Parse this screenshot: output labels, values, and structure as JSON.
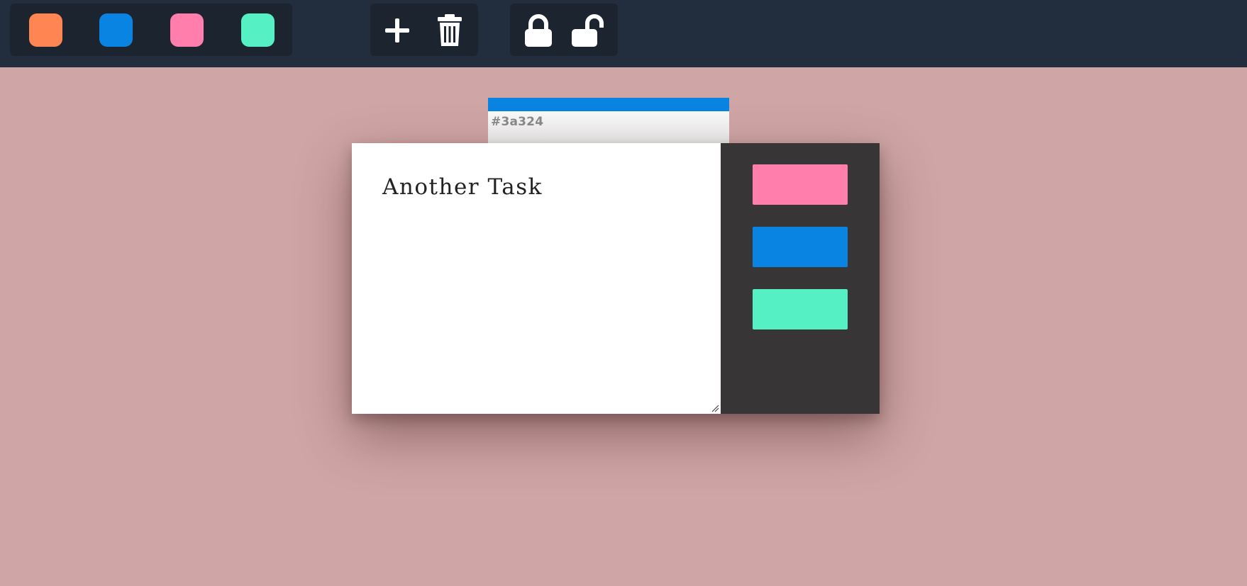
{
  "toolbar": {
    "color_swatches": [
      {
        "name": "orange",
        "color": "#ff8552"
      },
      {
        "name": "blue",
        "color": "#0a84e2"
      },
      {
        "name": "pink",
        "color": "#ff7eab"
      },
      {
        "name": "mint",
        "color": "#55f0c4"
      }
    ],
    "actions": [
      {
        "icon": "plus-icon"
      },
      {
        "icon": "trash-icon"
      }
    ],
    "locks": [
      {
        "icon": "lock-closed-icon"
      },
      {
        "icon": "lock-open-icon"
      }
    ]
  },
  "back_note": {
    "accent_color": "#0a84e2",
    "code": "#3a324"
  },
  "note": {
    "text": "Another Task",
    "panel_colors": [
      {
        "name": "pink",
        "color": "#ff7eab"
      },
      {
        "name": "blue",
        "color": "#0a84e2"
      },
      {
        "name": "mint",
        "color": "#55f0c4"
      }
    ]
  },
  "theme": {
    "background": "#cfa5a5",
    "topbar": "#222e3e",
    "panel": "#373536"
  }
}
